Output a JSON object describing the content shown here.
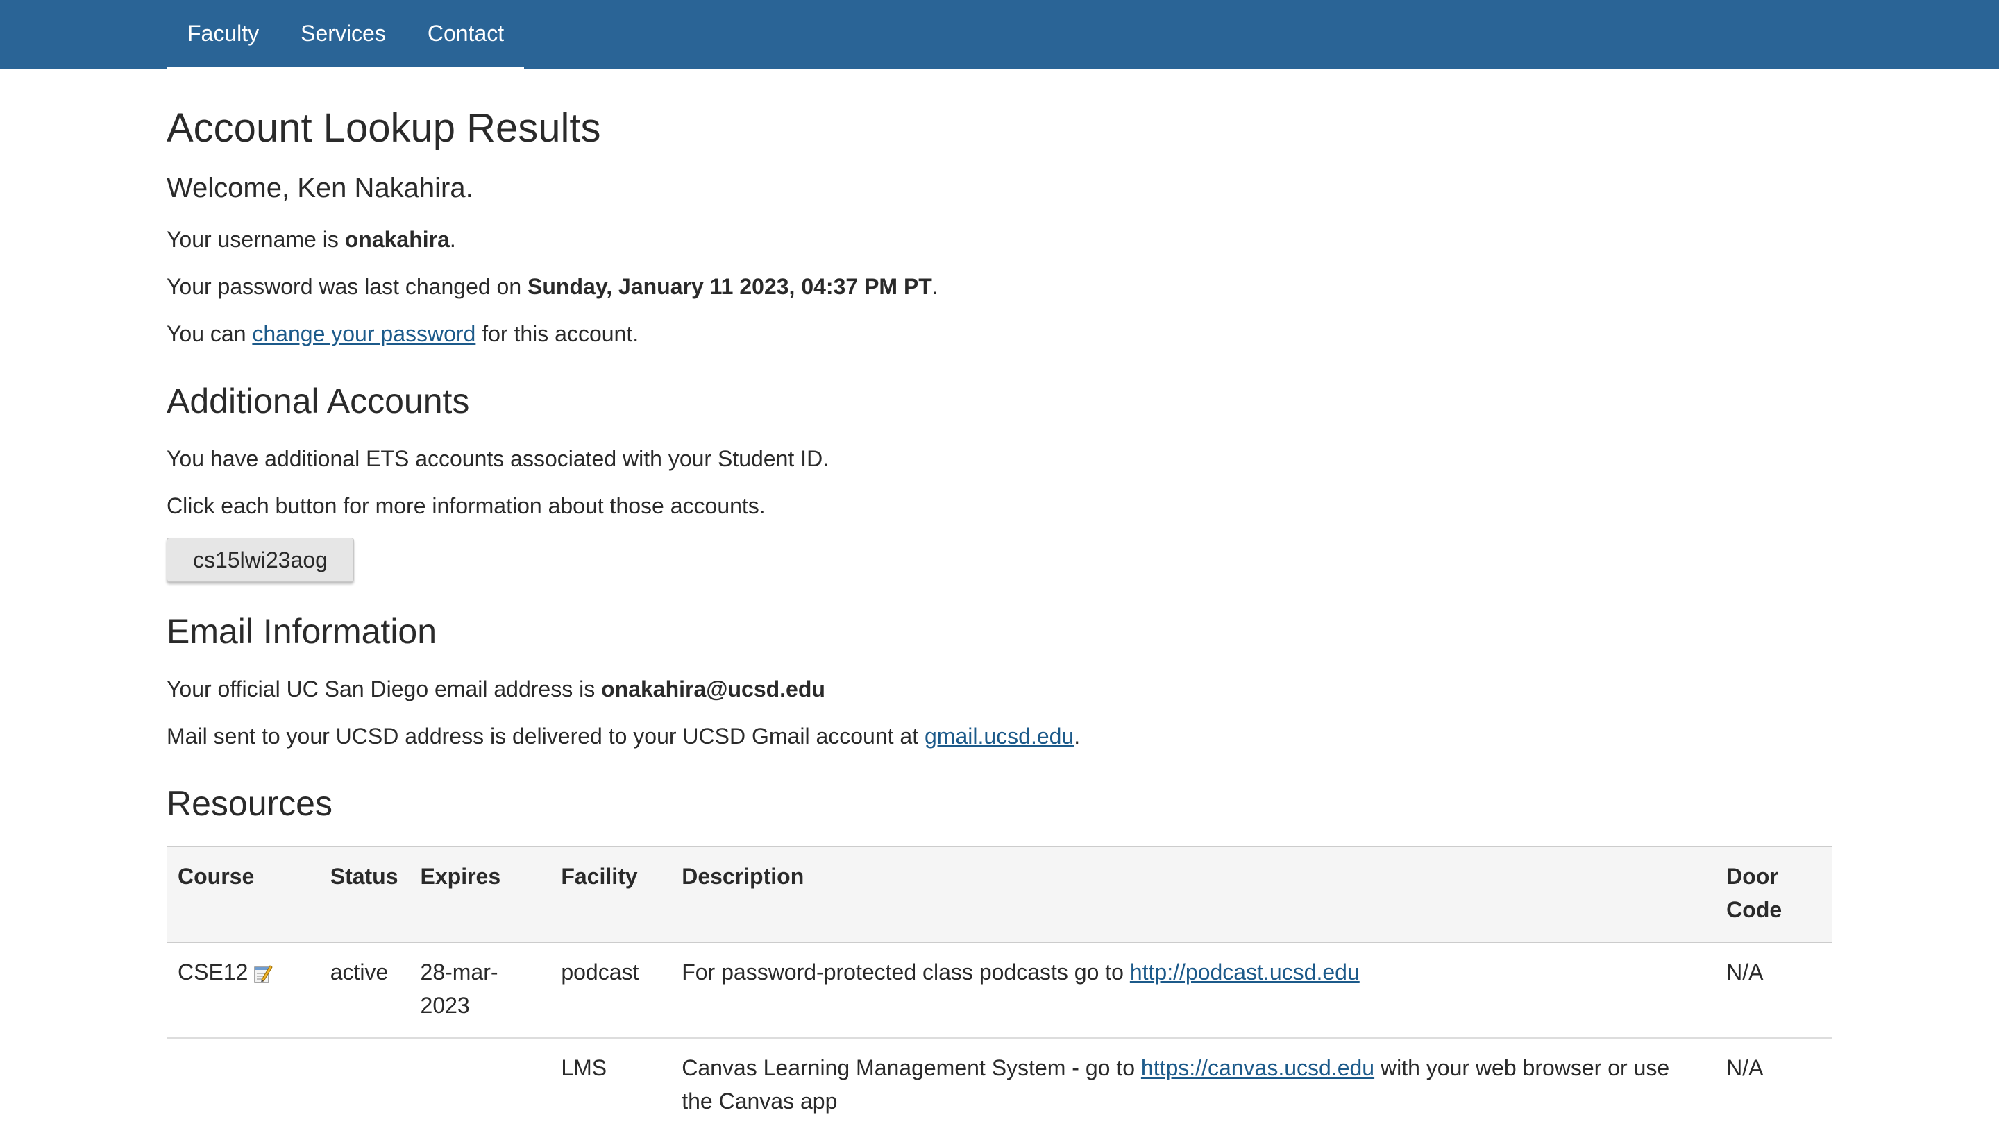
{
  "nav": {
    "items": [
      "Faculty",
      "Services",
      "Contact"
    ]
  },
  "page": {
    "title": "Account Lookup Results",
    "welcome": "Welcome, Ken Nakahira.",
    "username_prefix": "Your username is ",
    "username": "onakahira",
    "username_suffix": ".",
    "password_prefix": "Your password was last changed on ",
    "password_date": "Sunday, January 11 2023, 04:37 PM PT",
    "password_suffix": ".",
    "change_prefix": "You can ",
    "change_link": "change your password",
    "change_suffix": " for this account."
  },
  "additional": {
    "heading": "Additional Accounts",
    "line1": "You have additional ETS accounts associated with your Student ID.",
    "line2": "Click each button for more information about those accounts.",
    "account_button": "cs15lwi23aog"
  },
  "email": {
    "heading": "Email Information",
    "official_prefix": "Your official UC San Diego email address is ",
    "official_address": "onakahira@ucsd.edu",
    "mail_prefix": "Mail sent to your UCSD address is delivered to your UCSD Gmail account at ",
    "gmail_link": "gmail.ucsd.edu",
    "mail_suffix": "."
  },
  "resources": {
    "heading": "Resources",
    "columns": [
      "Course",
      "Status",
      "Expires",
      "Facility",
      "Description",
      "Door Code"
    ],
    "rows": [
      {
        "course": "CSE12",
        "status": "active",
        "expires": "28-mar-2023",
        "facility": "podcast",
        "desc_prefix": "For password-protected class podcasts go to ",
        "desc_link": "http://podcast.ucsd.edu",
        "desc_suffix": "",
        "door_code": "N/A"
      },
      {
        "course": "",
        "status": "",
        "expires": "",
        "facility": "LMS",
        "desc_prefix": "Canvas Learning Management System - go to ",
        "desc_link": "https://canvas.ucsd.edu",
        "desc_suffix": " with your web browser or use the Canvas app",
        "door_code": "N/A"
      }
    ]
  },
  "colors": {
    "header_bg": "#2a6496",
    "link": "#1c5a8a",
    "table_header_bg": "#f5f5f5"
  }
}
